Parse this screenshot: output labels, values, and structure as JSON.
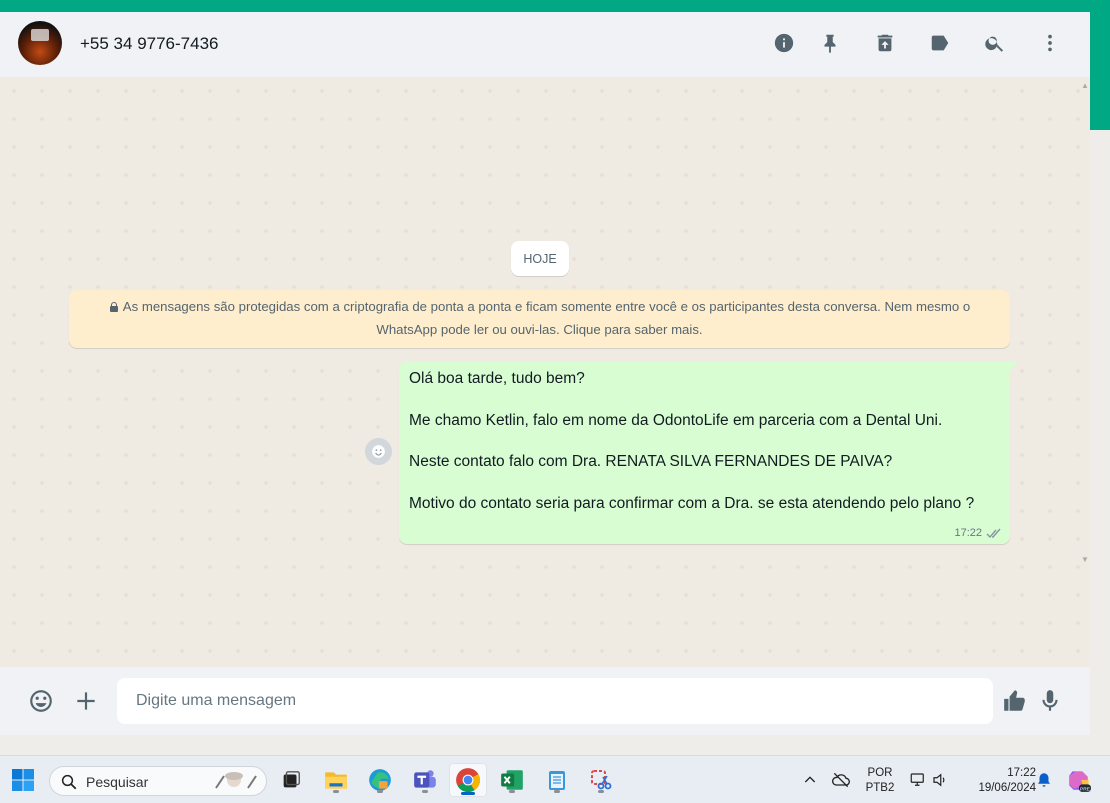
{
  "header": {
    "contact_name": "+55 34 9776-7436",
    "icons": [
      "info-icon",
      "pin-icon",
      "trash-icon",
      "label-icon",
      "search-icon",
      "more-vert-icon"
    ]
  },
  "chat": {
    "day_label": "HOJE",
    "encryption_notice": "As mensagens são protegidas com a criptografia de ponta a ponta e ficam somente entre você e os participantes desta conversa. Nem mesmo o WhatsApp pode ler ou ouvi-las. Clique para saber mais.",
    "message": {
      "lines": [
        "Olá boa tarde, tudo bem?",
        "Me chamo Ketlin, falo em nome da OdontoLife em parceria com a Dental Uni.",
        "Neste contato falo com Dra. RENATA SILVA FERNANDES DE PAIVA?",
        "Motivo do contato seria para confirmar com a Dra. se esta atendendo pelo plano ?"
      ],
      "time": "17:22",
      "status": "delivered-double-check"
    }
  },
  "composer": {
    "placeholder": "Digite uma mensagem"
  },
  "taskbar": {
    "search_label": "Pesquisar",
    "lang_top": "POR",
    "lang_bottom": "PTB2",
    "clock_time": "17:22",
    "clock_date": "19/06/2024"
  },
  "colors": {
    "accent": "#00a884",
    "outgoing_bubble": "#d9fdd3",
    "notice_bg": "#ffeecd",
    "chat_bg": "#efeae2"
  }
}
